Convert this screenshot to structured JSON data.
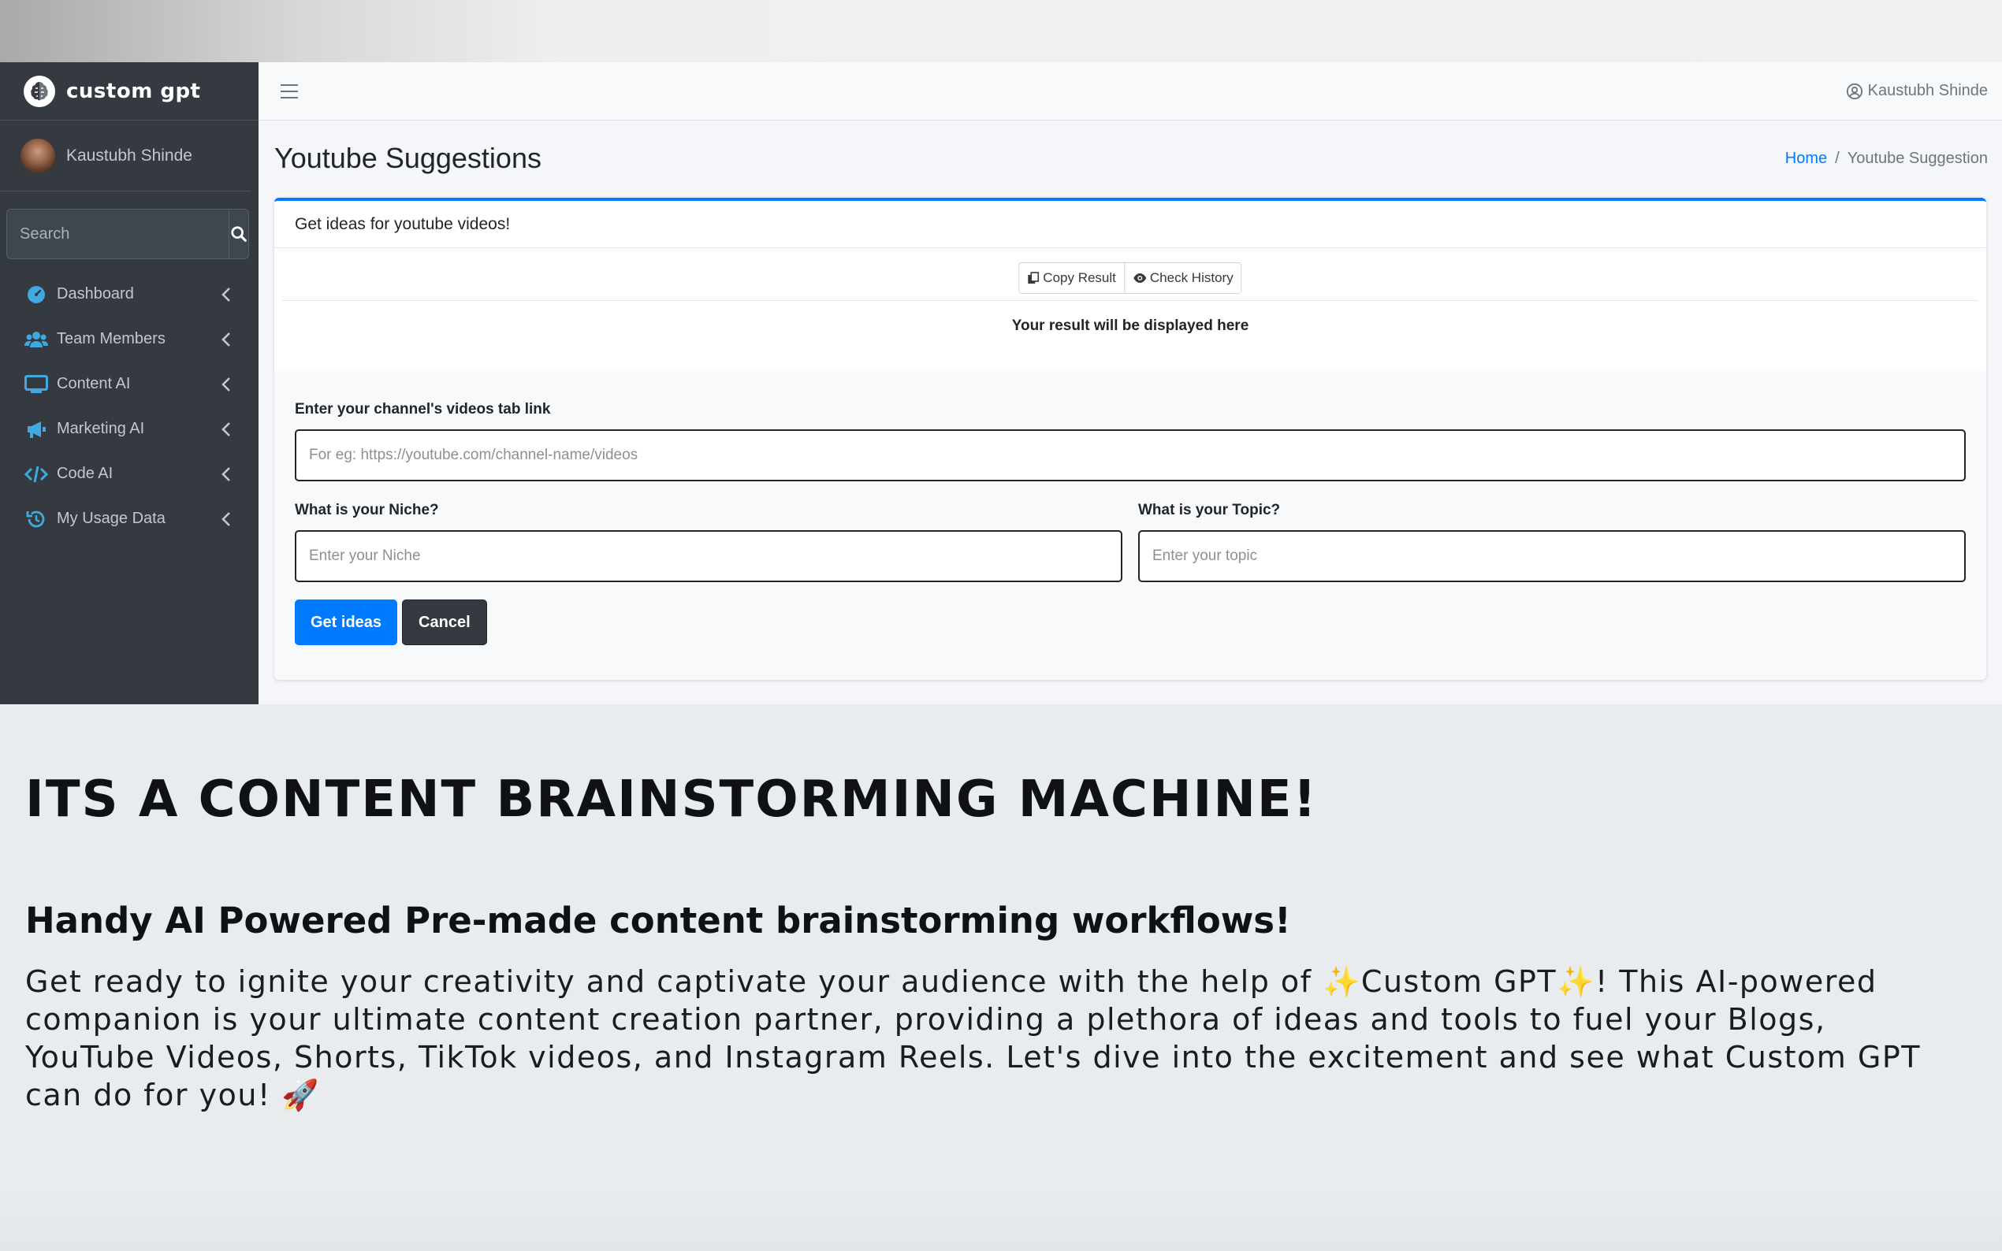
{
  "brand": {
    "name": "custom gpt"
  },
  "user": {
    "name": "Kaustubh Shinde"
  },
  "search": {
    "placeholder": "Search"
  },
  "sidebar": {
    "items": [
      {
        "label": "Dashboard",
        "icon": "dashboard-icon"
      },
      {
        "label": "Team Members",
        "icon": "users-icon"
      },
      {
        "label": "Content AI",
        "icon": "monitor-icon"
      },
      {
        "label": "Marketing AI",
        "icon": "megaphone-icon"
      },
      {
        "label": "Code AI",
        "icon": "code-icon"
      },
      {
        "label": "My Usage Data",
        "icon": "history-icon"
      }
    ]
  },
  "header": {
    "user_name": "Kaustubh Shinde"
  },
  "page": {
    "title": "Youtube Suggestions",
    "breadcrumb": {
      "home": "Home",
      "sep": "/",
      "current": "Youtube Suggestion"
    }
  },
  "card": {
    "header": "Get ideas for youtube videos!",
    "copy_label": "Copy Result",
    "history_label": "Check History",
    "result_text": "Your result will be displayed here"
  },
  "form": {
    "channel_label": "Enter your channel's videos tab link",
    "channel_placeholder": "For eg: https://youtube.com/channel-name/videos",
    "niche_label": "What is your Niche?",
    "niche_placeholder": "Enter your Niche",
    "topic_label": "What is your Topic?",
    "topic_placeholder": "Enter your topic",
    "submit_label": "Get ideas",
    "cancel_label": "Cancel"
  },
  "marketing": {
    "title": "ITS A CONTENT BRAINSTORMING MACHINE!",
    "subtitle": "Handy AI Powered Pre-made content brainstorming workflows!",
    "body": "Get ready to ignite your creativity and captivate your audience with the help of ✨Custom GPT✨! This AI-powered companion is your ultimate content creation partner, providing a plethora of ideas and tools to fuel your Blogs, YouTube Videos, Shorts, TikTok videos, and Instagram Reels. Let's dive into the excitement and see what Custom GPT can do for you! 🚀"
  },
  "colors": {
    "sidebar_bg": "#343a40",
    "primary": "#007bff",
    "nav_icon": "#3fa9e0"
  }
}
